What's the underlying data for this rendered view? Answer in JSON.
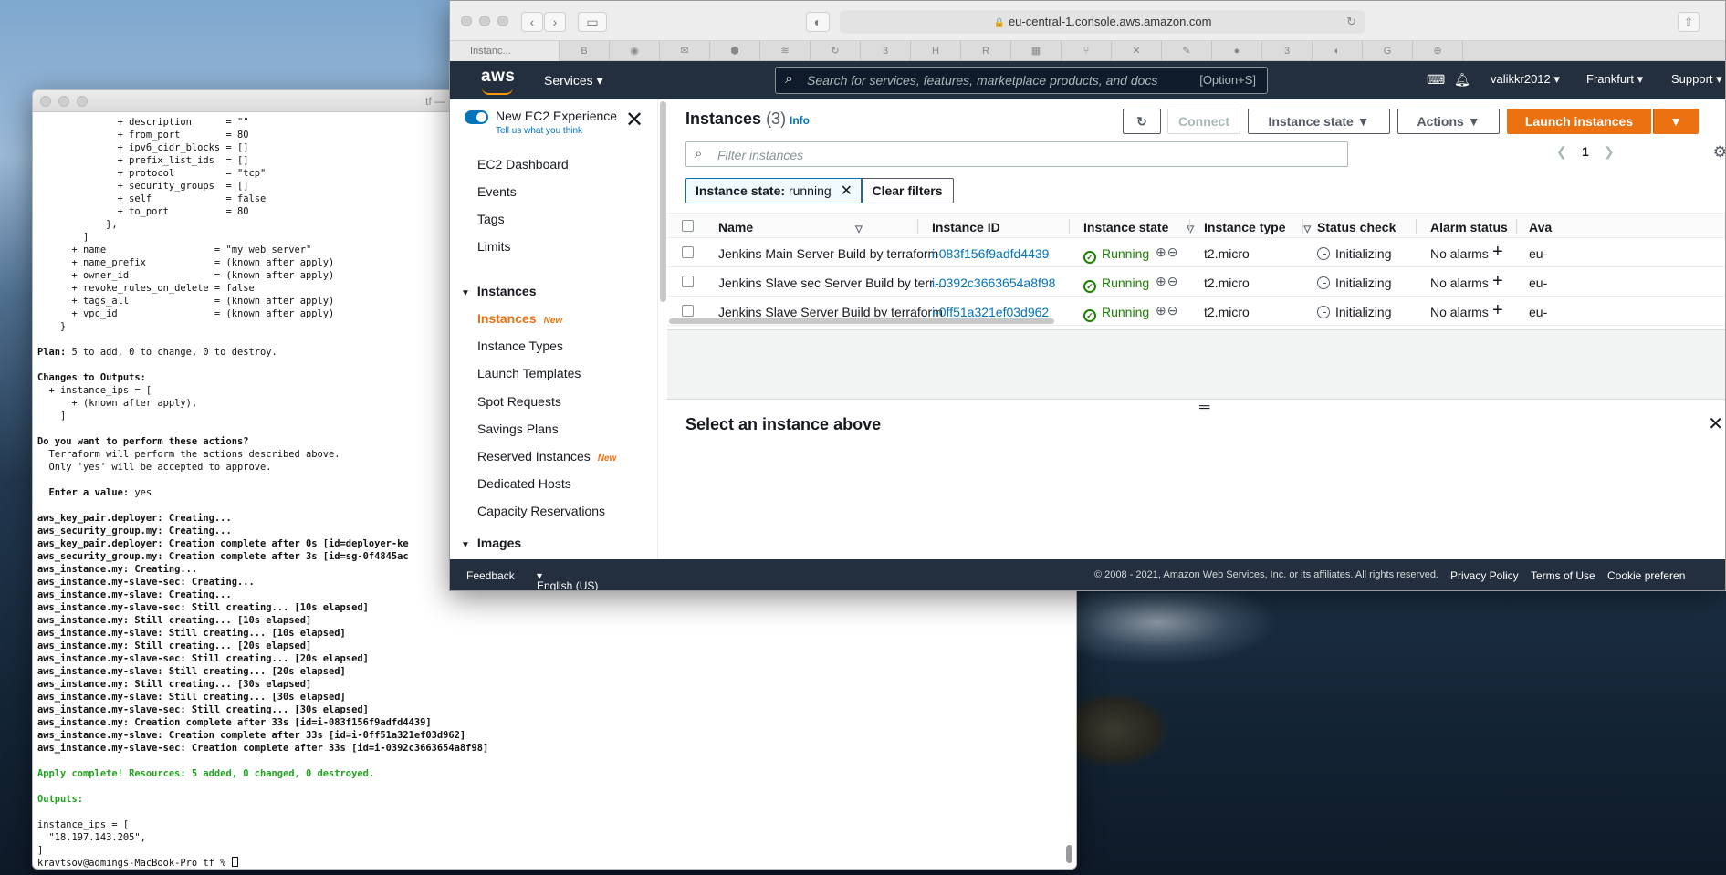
{
  "terminal": {
    "title": "tf — u",
    "lines": [
      {
        "t": "              + description      = \"\"",
        "c": ""
      },
      {
        "t": "              + from_port        = 80",
        "c": ""
      },
      {
        "t": "              + ipv6_cidr_blocks = []",
        "c": ""
      },
      {
        "t": "              + prefix_list_ids  = []",
        "c": ""
      },
      {
        "t": "              + protocol         = \"tcp\"",
        "c": ""
      },
      {
        "t": "              + security_groups  = []",
        "c": ""
      },
      {
        "t": "              + self             = false",
        "c": ""
      },
      {
        "t": "              + to_port          = 80",
        "c": ""
      },
      {
        "t": "            },",
        "c": ""
      },
      {
        "t": "        ]",
        "c": ""
      },
      {
        "t": "      + name                   = \"my_web_server\"",
        "c": ""
      },
      {
        "t": "      + name_prefix            = (known after apply)",
        "c": ""
      },
      {
        "t": "      + owner_id               = (known after apply)",
        "c": ""
      },
      {
        "t": "      + revoke_rules_on_delete = false",
        "c": ""
      },
      {
        "t": "      + tags_all               = (known after apply)",
        "c": ""
      },
      {
        "t": "      + vpc_id                 = (known after apply)",
        "c": ""
      },
      {
        "t": "    }",
        "c": ""
      },
      {
        "t": "",
        "c": ""
      },
      {
        "t": "Plan: 5 to add, 0 to change, 0 to destroy.",
        "c": "bold-first"
      },
      {
        "t": "",
        "c": ""
      },
      {
        "t": "Changes to Outputs:",
        "c": "bold"
      },
      {
        "t": "  + instance_ips = [",
        "c": ""
      },
      {
        "t": "      + (known after apply),",
        "c": ""
      },
      {
        "t": "    ]",
        "c": ""
      },
      {
        "t": "",
        "c": ""
      },
      {
        "t": "Do you want to perform these actions?",
        "c": "bold"
      },
      {
        "t": "  Terraform will perform the actions described above.",
        "c": ""
      },
      {
        "t": "  Only 'yes' will be accepted to approve.",
        "c": ""
      },
      {
        "t": "",
        "c": ""
      },
      {
        "t": "  Enter a value: yes",
        "c": "bold-first"
      },
      {
        "t": "",
        "c": ""
      },
      {
        "t": "aws_key_pair.deployer: Creating...",
        "c": "bold"
      },
      {
        "t": "aws_security_group.my: Creating...",
        "c": "bold"
      },
      {
        "t": "aws_key_pair.deployer: Creation complete after 0s [id=deployer-ke",
        "c": "bold"
      },
      {
        "t": "aws_security_group.my: Creation complete after 3s [id=sg-0f4845ac",
        "c": "bold"
      },
      {
        "t": "aws_instance.my: Creating...",
        "c": "bold"
      },
      {
        "t": "aws_instance.my-slave-sec: Creating...",
        "c": "bold"
      },
      {
        "t": "aws_instance.my-slave: Creating...",
        "c": "bold"
      },
      {
        "t": "aws_instance.my-slave-sec: Still creating... [10s elapsed]",
        "c": "bold"
      },
      {
        "t": "aws_instance.my: Still creating... [10s elapsed]",
        "c": "bold"
      },
      {
        "t": "aws_instance.my-slave: Still creating... [10s elapsed]",
        "c": "bold"
      },
      {
        "t": "aws_instance.my: Still creating... [20s elapsed]",
        "c": "bold"
      },
      {
        "t": "aws_instance.my-slave-sec: Still creating... [20s elapsed]",
        "c": "bold"
      },
      {
        "t": "aws_instance.my-slave: Still creating... [20s elapsed]",
        "c": "bold"
      },
      {
        "t": "aws_instance.my: Still creating... [30s elapsed]",
        "c": "bold"
      },
      {
        "t": "aws_instance.my-slave: Still creating... [30s elapsed]",
        "c": "bold"
      },
      {
        "t": "aws_instance.my-slave-sec: Still creating... [30s elapsed]",
        "c": "bold"
      },
      {
        "t": "aws_instance.my: Creation complete after 33s [id=i-083f156f9adfd4439]",
        "c": "bold"
      },
      {
        "t": "aws_instance.my-slave: Creation complete after 33s [id=i-0ff51a321ef03d962]",
        "c": "bold"
      },
      {
        "t": "aws_instance.my-slave-sec: Creation complete after 33s [id=i-0392c3663654a8f98]",
        "c": "bold"
      },
      {
        "t": "",
        "c": ""
      },
      {
        "t": "Apply complete! Resources: 5 added, 0 changed, 0 destroyed.",
        "c": "green"
      },
      {
        "t": "",
        "c": ""
      },
      {
        "t": "Outputs:",
        "c": "green"
      },
      {
        "t": "",
        "c": ""
      },
      {
        "t": "instance_ips = [",
        "c": ""
      },
      {
        "t": "  \"18.197.143.205\",",
        "c": ""
      },
      {
        "t": "]",
        "c": ""
      },
      {
        "t": "kravtsov@admings-MacBook-Pro tf % ",
        "c": "prompt"
      }
    ]
  },
  "browser": {
    "url": "eu-central-1.console.aws.amazon.com",
    "active_tab": "Instanc...",
    "tab_icons": [
      "B",
      "◉",
      "✉",
      "⬢",
      "≋",
      "↻",
      "3",
      "H",
      "R",
      "▦",
      "⑂",
      "✕",
      "✎",
      "●",
      "3",
      "◐",
      "G",
      "⊕"
    ]
  },
  "aws_nav": {
    "logo": "aws",
    "services": "Services",
    "search_placeholder": "Search for services, features, marketplace products, and docs",
    "search_shortcut": "[Option+S]",
    "user": "valikkr2012",
    "region": "Frankfurt",
    "support": "Support"
  },
  "sidebar": {
    "new_experience": "New EC2 Experience",
    "tell_us": "Tell us what you think",
    "top_items": [
      "EC2 Dashboard",
      "Events",
      "Tags",
      "Limits"
    ],
    "group_instances": "Instances",
    "instances_items": [
      {
        "label": "Instances",
        "badge": "New",
        "selected": true
      },
      {
        "label": "Instance Types",
        "badge": "",
        "selected": false
      },
      {
        "label": "Launch Templates",
        "badge": "",
        "selected": false
      },
      {
        "label": "Spot Requests",
        "badge": "",
        "selected": false
      },
      {
        "label": "Savings Plans",
        "badge": "",
        "selected": false
      },
      {
        "label": "Reserved Instances",
        "badge": "New",
        "selected": false
      },
      {
        "label": "Dedicated Hosts",
        "badge": "",
        "selected": false
      },
      {
        "label": "Capacity Reservations",
        "badge": "",
        "selected": false
      }
    ],
    "group_images": "Images"
  },
  "main": {
    "title": "Instances",
    "count": "(3)",
    "info": "Info",
    "btn_connect": "Connect",
    "btn_state": "Instance state",
    "btn_actions": "Actions",
    "btn_launch": "Launch instances",
    "filter_placeholder": "Filter instances",
    "page": "1",
    "chip_key": "Instance state:",
    "chip_value": "running",
    "clear_filters": "Clear filters",
    "columns": [
      "Name",
      "Instance ID",
      "Instance state",
      "Instance type",
      "Status check",
      "Alarm status",
      "Ava"
    ],
    "rows": [
      {
        "name": "Jenkins Main Server Build by terraform",
        "id": "i-083f156f9adfd4439",
        "state": "Running",
        "type": "t2.micro",
        "status": "Initializing",
        "alarm": "No alarms",
        "az": "eu-"
      },
      {
        "name": "Jenkins Slave sec Server Build by terr…",
        "id": "i-0392c3663654a8f98",
        "state": "Running",
        "type": "t2.micro",
        "status": "Initializing",
        "alarm": "No alarms",
        "az": "eu-"
      },
      {
        "name": "Jenkins Slave Server Build by terraform",
        "id": "i-0ff51a321ef03d962",
        "state": "Running",
        "type": "t2.micro",
        "status": "Initializing",
        "alarm": "No alarms",
        "az": "eu-"
      }
    ],
    "select_prompt": "Select an instance above"
  },
  "footer": {
    "feedback": "Feedback",
    "language": "English (US)",
    "copyright": "© 2008 - 2021, Amazon Web Services, Inc. or its affiliates. All rights reserved.",
    "privacy": "Privacy Policy",
    "terms": "Terms of Use",
    "cookie": "Cookie preferen"
  }
}
